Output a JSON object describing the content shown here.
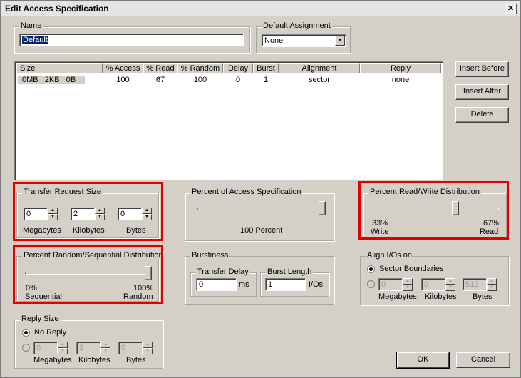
{
  "window": {
    "title": "Edit Access Specification",
    "close_glyph": "✕"
  },
  "name_group": {
    "legend": "Name",
    "value": "Default"
  },
  "default_assignment": {
    "legend": "Default Assignment",
    "selected": "None"
  },
  "table": {
    "headers": [
      "Size",
      "% Access",
      "% Read",
      "% Random",
      "Delay",
      "Burst",
      "Alignment",
      "Reply"
    ],
    "rows": [
      {
        "size": "0MB   2KB   0B",
        "access": "100",
        "read": "67",
        "random": "100",
        "delay": "0",
        "burst": "1",
        "alignment": "sector",
        "reply": "none"
      }
    ]
  },
  "side_buttons": {
    "insert_before": "Insert Before",
    "insert_after": "Insert After",
    "delete": "Delete"
  },
  "transfer_request_size": {
    "legend": "Transfer Request Size",
    "megabytes": {
      "value": "0",
      "label": "Megabytes"
    },
    "kilobytes": {
      "value": "2",
      "label": "Kilobytes"
    },
    "bytes": {
      "value": "0",
      "label": "Bytes"
    }
  },
  "percent_access": {
    "legend": "Percent of Access Specification",
    "value_label": "100 Percent",
    "level": 1.0
  },
  "percent_read_write": {
    "legend": "Percent Read/Write Distribution",
    "left_pct": "33%",
    "left_label": "Write",
    "right_pct": "67%",
    "right_label": "Read",
    "level": 0.67
  },
  "percent_random": {
    "legend": "Percent Random/Sequential Distribution",
    "left_pct": "0%",
    "left_label": "Sequential",
    "right_pct": "100%",
    "right_label": "Random",
    "level": 1.0
  },
  "burstiness": {
    "legend": "Burstiness",
    "transfer_delay": {
      "legend": "Transfer Delay",
      "value": "0",
      "unit": "ms"
    },
    "burst_length": {
      "legend": "Burst Length",
      "value": "1",
      "unit": "I/Os"
    }
  },
  "align_ios": {
    "legend": "Align I/Os on",
    "sector_label": "Sector Boundaries",
    "megabytes": {
      "value": "0",
      "label": "Megabytes"
    },
    "kilobytes": {
      "value": "0",
      "label": "Kilobytes"
    },
    "bytes": {
      "value": "512",
      "label": "Bytes"
    }
  },
  "reply_size": {
    "legend": "Reply Size",
    "no_reply_label": "No Reply",
    "megabytes": {
      "value": "0",
      "label": "Megabytes"
    },
    "kilobytes": {
      "value": "2",
      "label": "Kilobytes"
    },
    "bytes": {
      "value": "0",
      "label": "Bytes"
    }
  },
  "footer": {
    "ok": "OK",
    "cancel": "Cancel"
  },
  "colors": {
    "highlight_box": "#e00000",
    "dialog_bg": "#d4d0c8"
  }
}
